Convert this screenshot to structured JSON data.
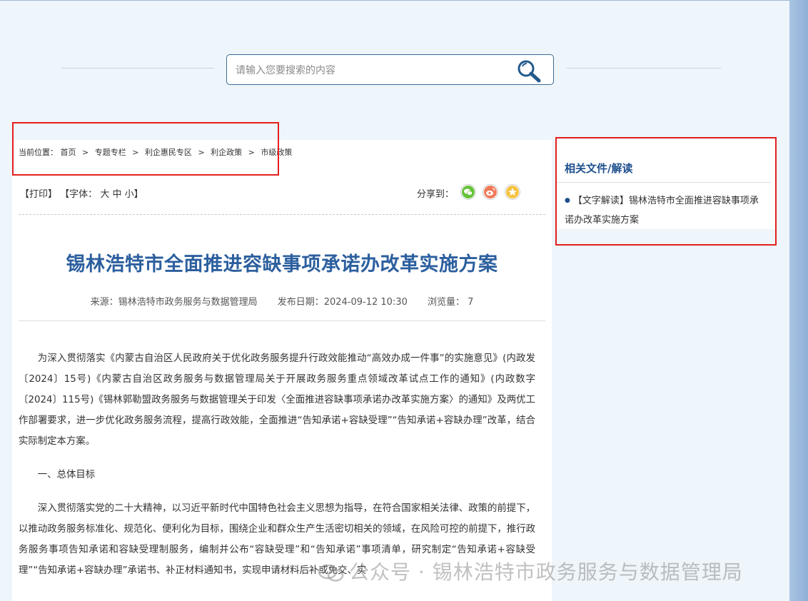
{
  "search": {
    "placeholder": "请输入您要搜索的内容"
  },
  "breadcrumb": {
    "label": "当前位置：",
    "items": [
      "首页",
      "专题专栏",
      "利企惠民专区",
      "利企政策",
      "市级政策"
    ]
  },
  "tools": {
    "print": "【打印】",
    "font_prefix": "【字体：",
    "font_large": "大",
    "font_medium": "中",
    "font_small": "小",
    "font_suffix": "】",
    "share_label": "分享到："
  },
  "article": {
    "title": "锡林浩特市全面推进容缺事项承诺办改革实施方案",
    "source": "来源：锡林浩特市政务服务与数据管理局",
    "date": "发布日期：2024-09-12 10:30",
    "views": "浏览量： 7",
    "paragraphs": [
      "为深入贯彻落实《内蒙古自治区人民政府关于优化政务服务提升行政效能推动“高效办成一件事”的实施意见》(内政发〔2024〕15号)《内蒙古自治区政务服务与数据管理局关于开展政务服务重点领域改革试点工作的通知》(内政数字〔2024〕115号)《锡林郭勒盟政务服务与数据管理关于印发〈全面推进容缺事项承诺办改革实施方案〉的通知》及两优工作部署要求，进一步优化政务服务流程，提高行政效能，全面推进“告知承诺+容缺受理”“告知承诺+容缺办理”改革，结合实际制定本方案。",
      "一、总体目标",
      "深入贯彻落实党的二十大精神，以习近平新时代中国特色社会主义思想为指导，在符合国家相关法律、政策的前提下，以推动政务服务标准化、规范化、便利化为目标，围绕企业和群众生产生活密切相关的领域，在风险可控的前提下，推行政务服务事项告知承诺和容缺受理制服务，编制并公布“容缺受理”和“告知承诺”事项清单，研究制定“告知承诺+容缺受理”“告知承诺+容缺办理”承诺书、补正材料通知书，实现申请材料后补或免交、实"
    ]
  },
  "sidebar": {
    "title": "相关文件/解读",
    "link": "【文字解读】锡林浩特市全面推进容缺事项承诺办改革实施方案"
  },
  "watermark": {
    "text": "公众号 · 锡林浩特市政务服务与数据管理局"
  },
  "colors": {
    "title_blue": "#2c5f9e",
    "highlight_red": "#e41f1f",
    "background": "#eef5fb"
  },
  "icons": [
    "search-icon",
    "wechat-icon",
    "weibo-icon",
    "favorite-star-icon",
    "watermark-logo-icon"
  ]
}
